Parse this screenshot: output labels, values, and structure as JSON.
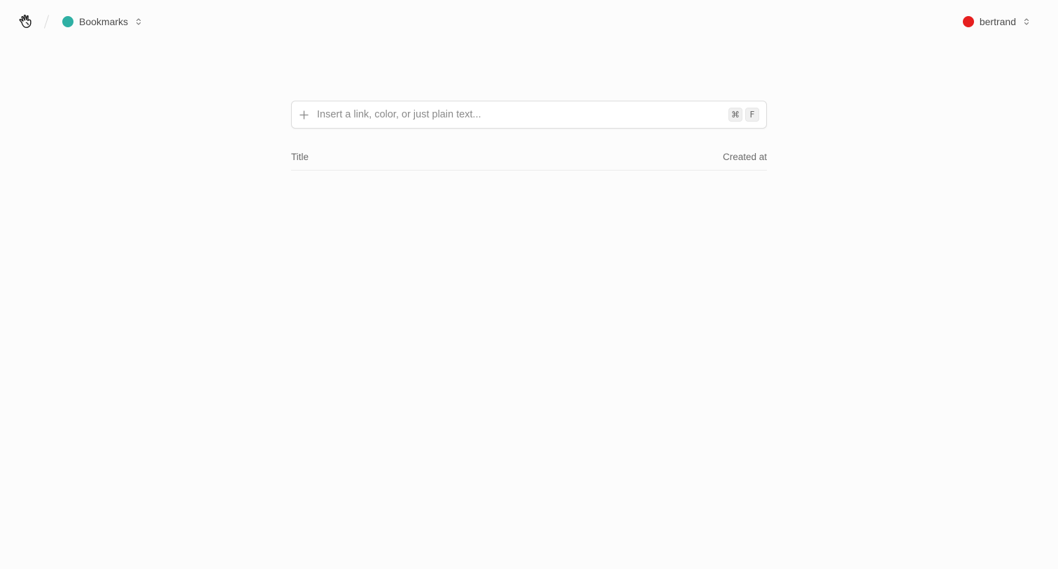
{
  "header": {
    "collection": {
      "label": "Bookmarks",
      "color": "#2fb0a4"
    },
    "user": {
      "label": "bertrand",
      "color": "#e61f1f"
    }
  },
  "composer": {
    "placeholder": "Insert a link, color, or just plain text...",
    "value": "",
    "shortcut_keys": [
      "⌘",
      "F"
    ]
  },
  "table": {
    "columns": [
      "Title",
      "Created at"
    ],
    "rows": []
  }
}
